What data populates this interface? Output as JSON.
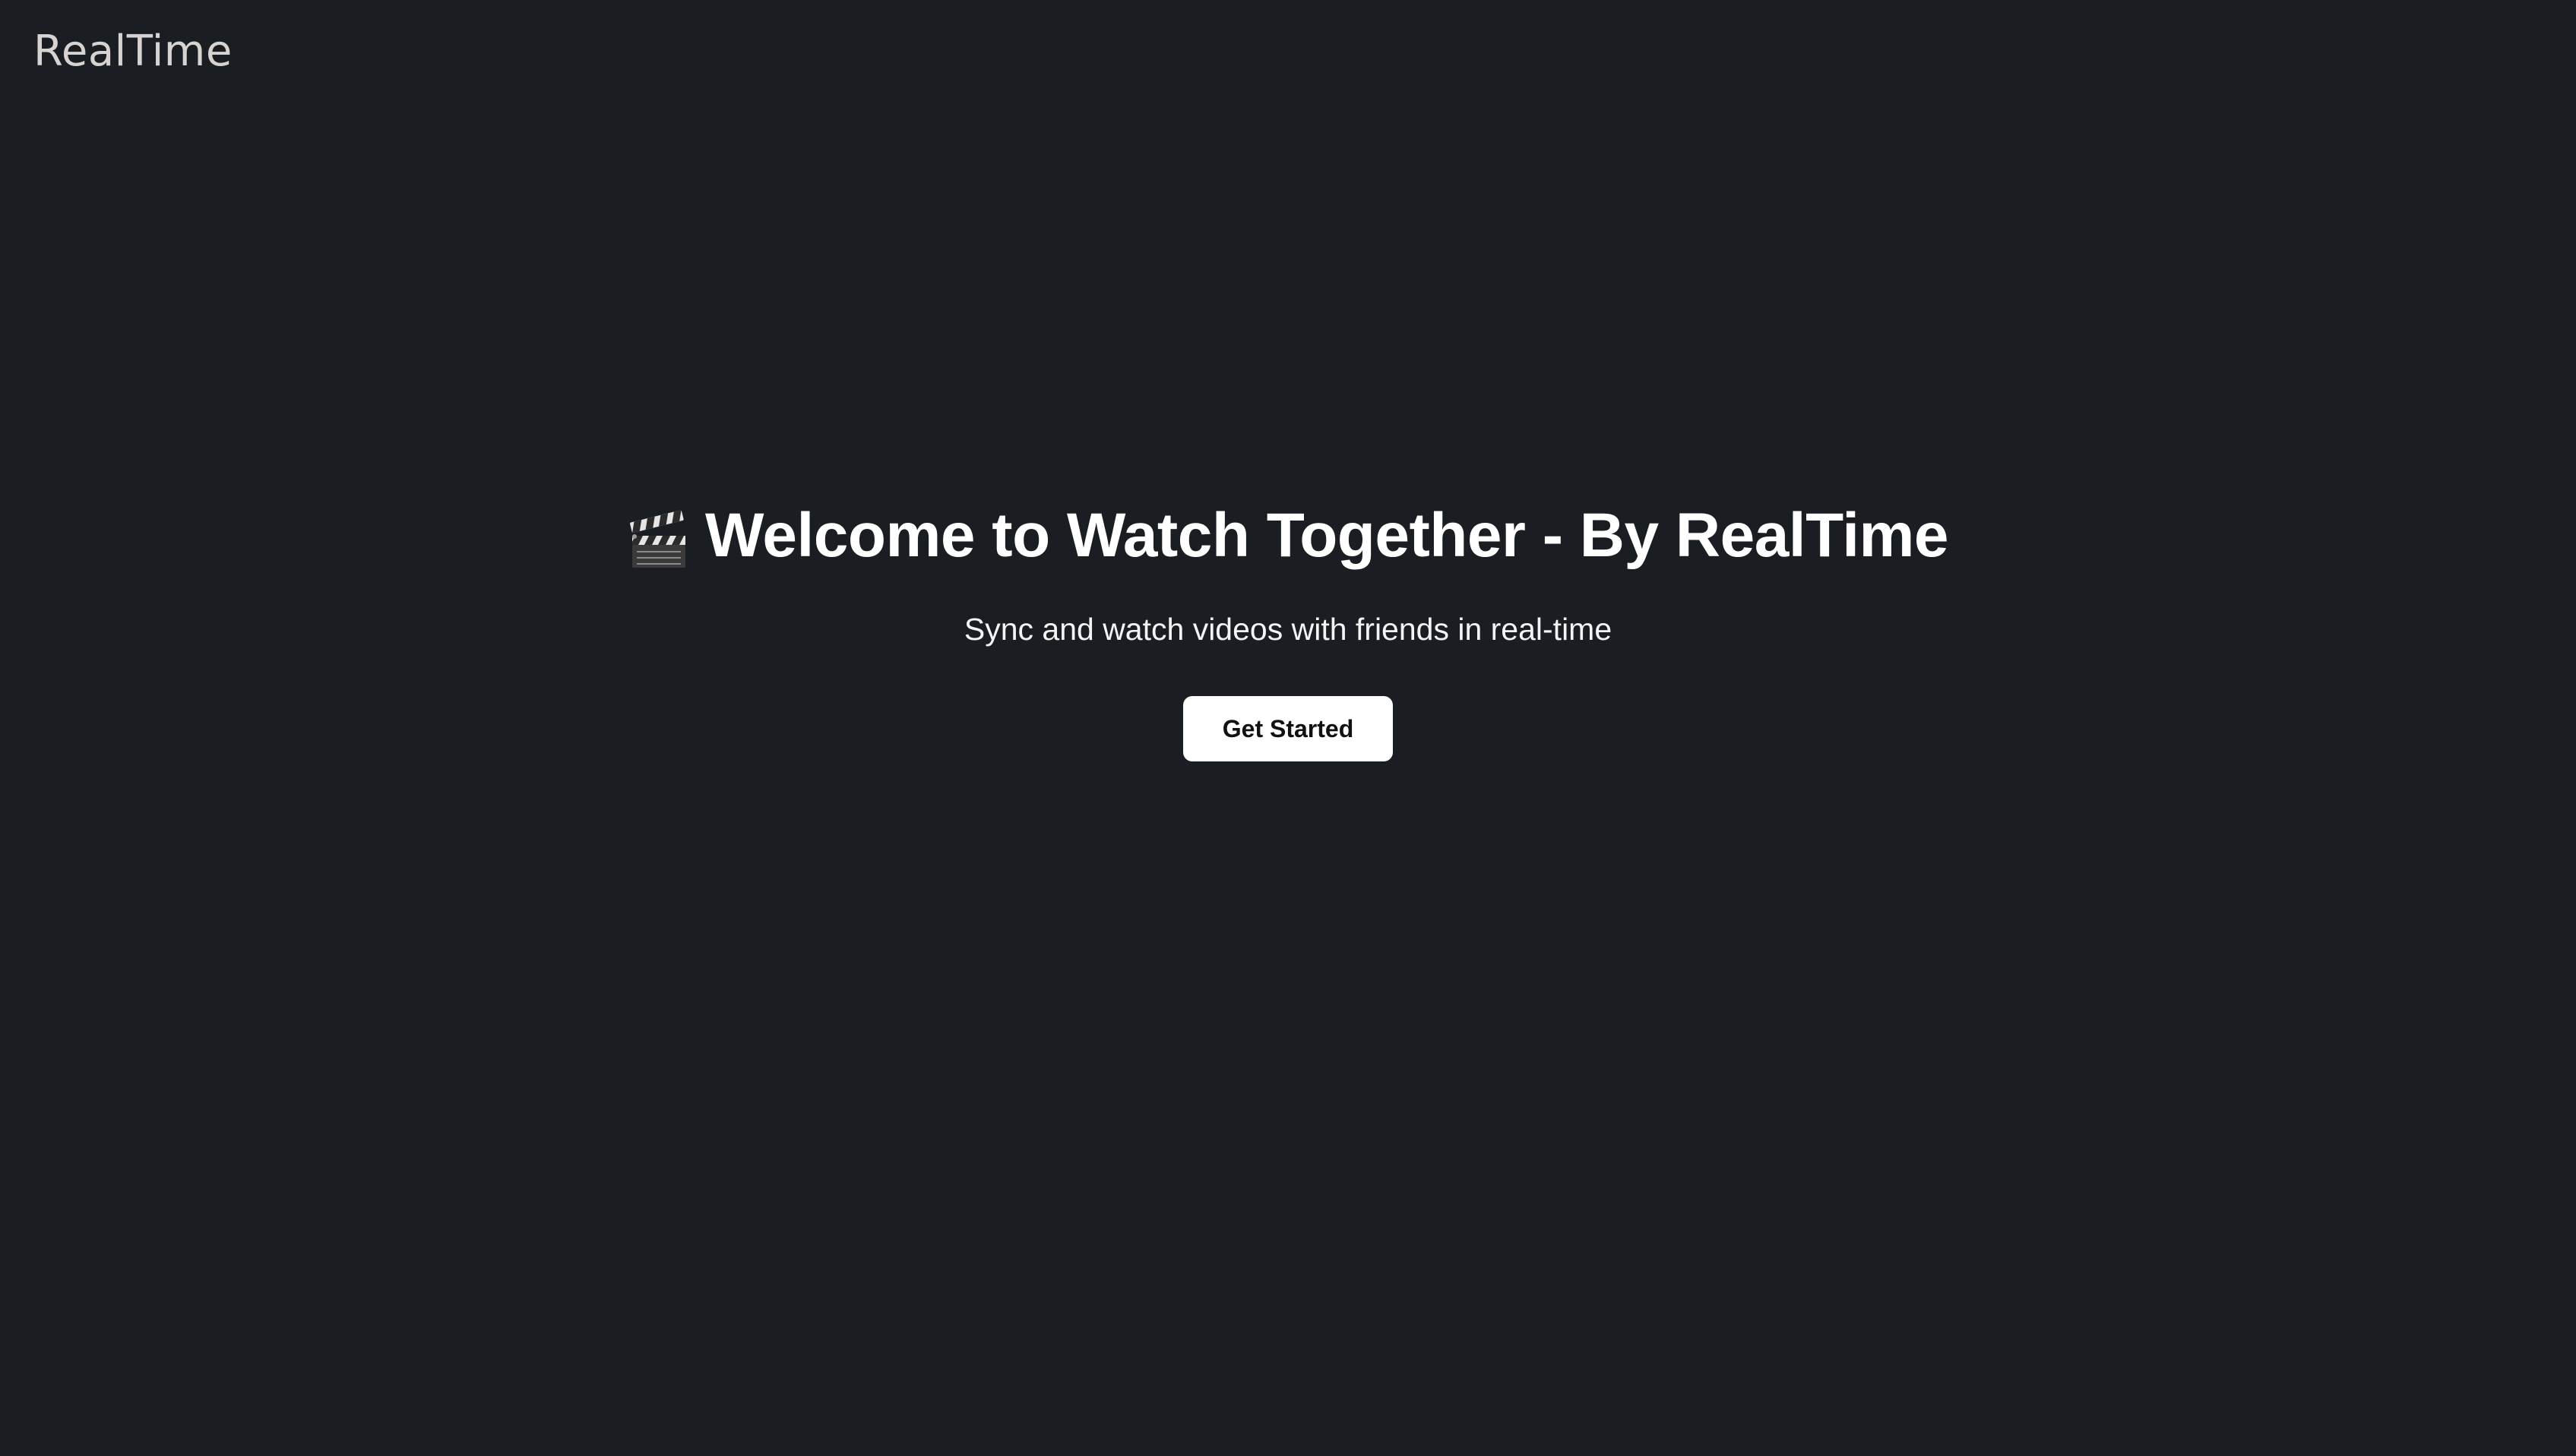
{
  "header": {
    "logo_text": "RealTime"
  },
  "hero": {
    "icon": "clapper-board-icon",
    "title": "Welcome to Watch Together - By RealTime",
    "subtitle": "Sync and watch videos with friends in real-time",
    "cta_label": "Get Started"
  },
  "colors": {
    "background": "#1a1d22",
    "logo": "#d6d3d1",
    "title": "#ffffff",
    "button_bg": "#ffffff",
    "button_text": "#111111"
  }
}
